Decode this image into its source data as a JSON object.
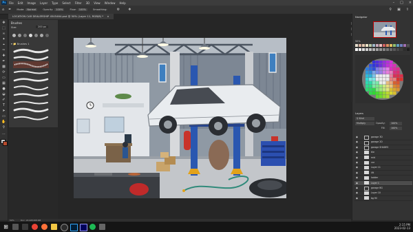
{
  "menubar": {
    "logo": "Ps",
    "items": [
      "File",
      "Edit",
      "Image",
      "Layer",
      "Type",
      "Select",
      "Filter",
      "3D",
      "View",
      "Window",
      "Help"
    ]
  },
  "options_bar": {
    "mode_label": "Mode:",
    "mode_value": "Normal",
    "opacity_label": "Opacity:",
    "opacity_value": "100%",
    "flow_label": "Flow:",
    "flow_value": "100%",
    "smoothing_label": "Smoothing:"
  },
  "document_tab": {
    "title": "LOCATION CAR DEALERSHIP 4545464.psd @ 50% (Layer 11, RGB/8) *"
  },
  "brushes_panel": {
    "title": "Brushes",
    "size_label": "Size:",
    "size_value": "200 px",
    "folder": "Brushes 1"
  },
  "status_bar": {
    "zoom": "50%",
    "doc_size": "Doc: 24.9M/468.6M"
  },
  "navigator": {
    "title": "Navigator",
    "zoom": "50%"
  },
  "swatches_colors": [
    "#e8e0d0",
    "#d9b3a0",
    "#e6c8b0",
    "#f0e6c8",
    "#b8c8a8",
    "#a0b8c8",
    "#c8a8b8",
    "#f0c0c0",
    "#d06060",
    "#e09060",
    "#e0c060",
    "#90c070",
    "#60a0c0",
    "#7080c0",
    "#a070b0",
    "#505050"
  ],
  "layers_panel": {
    "title": "Layers",
    "kind_label": "Kind",
    "blend_mode": "Multiply",
    "opacity_label": "Opacity:",
    "opacity_value": "100%",
    "fill_label": "Fill:",
    "fill_value": "100%",
    "layers": [
      {
        "name": "garage 3D",
        "type": "group",
        "visible": true
      },
      {
        "name": "garage 2D",
        "type": "group",
        "visible": true
      },
      {
        "name": "garage SHADES",
        "type": "group",
        "visible": true
      },
      {
        "name": "tile",
        "type": "layer",
        "visible": true
      },
      {
        "name": "mid",
        "type": "layer",
        "visible": true
      },
      {
        "name": "car",
        "type": "layer",
        "visible": true
      },
      {
        "name": "Layer 11",
        "type": "layer",
        "visible": true
      },
      {
        "name": "lift",
        "type": "layer",
        "visible": true
      },
      {
        "name": "ladder",
        "type": "layer",
        "visible": true
      },
      {
        "name": "Layer 1",
        "type": "layer",
        "visible": true,
        "selected": true
      },
      {
        "name": "garage BG",
        "type": "group",
        "visible": true
      },
      {
        "name": "Layer 10",
        "type": "layer",
        "visible": true
      },
      {
        "name": "bg fill",
        "type": "layer",
        "visible": true
      }
    ]
  },
  "taskbar": {
    "time": "2:15 PM",
    "date": "2023-02-13",
    "icons": [
      "windows-start",
      "search",
      "task-view",
      "chrome",
      "firefox",
      "folder",
      "obs",
      "photoshop",
      "after-effects",
      "spotify",
      "settings"
    ]
  },
  "canvas_art": {
    "wall_color": "#9aa3ad",
    "floor_color": "#c4c6c8",
    "lift_color": "#2a57b0",
    "car_color": "#e8eaee",
    "extinguisher_color": "#c8332a",
    "toolbox_color": "#2b4fb0"
  }
}
